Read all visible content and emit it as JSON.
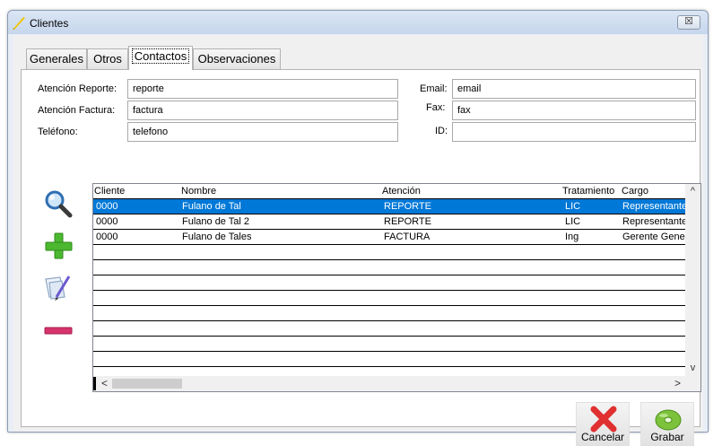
{
  "window": {
    "title": "Clientes",
    "close_glyph": "☒"
  },
  "tabs": [
    {
      "label": "Generales",
      "active": false
    },
    {
      "label": "Otros",
      "active": false
    },
    {
      "label": "Contactos",
      "active": true
    },
    {
      "label": "Observaciones",
      "active": false
    }
  ],
  "form": {
    "atencion_reporte": {
      "label": "Atención Reporte:",
      "value": "reporte"
    },
    "atencion_factura": {
      "label": "Atención Factura:",
      "value": "factura"
    },
    "telefono": {
      "label": "Teléfono:",
      "value": "telefono"
    },
    "email": {
      "label": "Email:",
      "value": "email"
    },
    "fax": {
      "label": "Fax:",
      "value": "fax"
    },
    "id": {
      "label": "ID:",
      "value": ""
    }
  },
  "side_buttons": {
    "search": "search-icon",
    "add": "plus-icon",
    "edit": "edit-document-icon",
    "remove": "minus-icon"
  },
  "table": {
    "columns": [
      "Cliente",
      "Nombre",
      "Atención",
      "Tratamiento",
      "Cargo"
    ],
    "rows": [
      {
        "cliente": "0000",
        "nombre": "Fulano de Tal",
        "atencion": "REPORTE",
        "tratamiento": "LIC",
        "cargo": "Representante",
        "selected": true
      },
      {
        "cliente": "0000",
        "nombre": "Fulano de Tal 2",
        "atencion": "REPORTE",
        "tratamiento": "LIC",
        "cargo": "Representante",
        "selected": false
      },
      {
        "cliente": "0000",
        "nombre": "Fulano de Tales",
        "atencion": "FACTURA",
        "tratamiento": "Ing",
        "cargo": "Gerente General",
        "selected": false
      }
    ],
    "scroll_up": "^",
    "scroll_down": "v",
    "scroll_left": "<",
    "scroll_right": ">"
  },
  "actions": {
    "cancel": "Cancelar",
    "save": "Grabar"
  },
  "colors": {
    "selection": "#0078d7",
    "cancel_icon": "#e03030",
    "save_icon": "#7cc23a",
    "add_icon": "#4cb830",
    "remove_icon": "#d6336c"
  }
}
